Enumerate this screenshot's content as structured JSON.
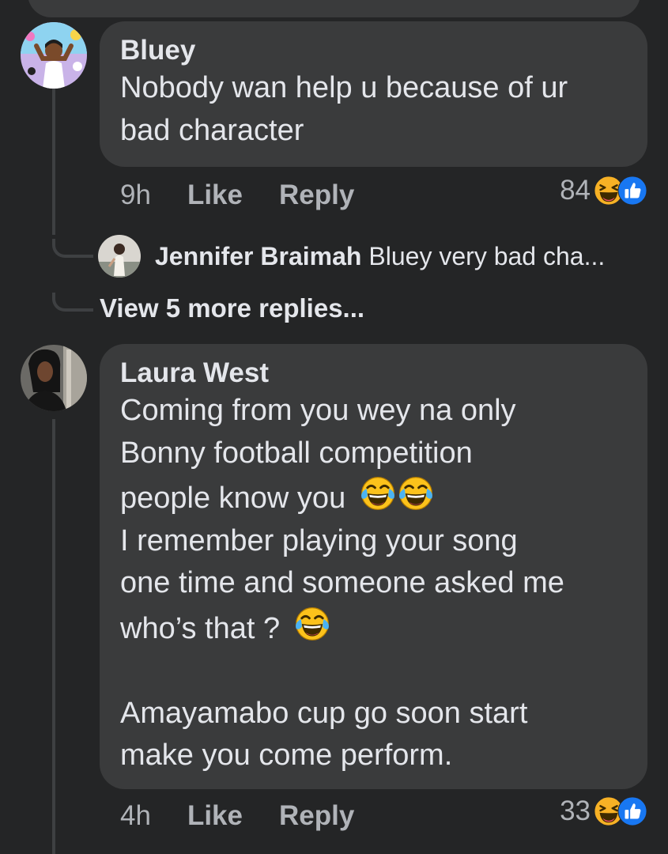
{
  "comments": [
    {
      "author": "Bluey",
      "text": "Nobody wan help u because of ur\nbad character",
      "time": "9h",
      "like_label": "Like",
      "reply_label": "Reply",
      "reaction_count": "84",
      "reactions": [
        "haha-emoji",
        "like-reaction"
      ],
      "reply_preview": {
        "author": "Jennifer Braimah",
        "text": "Bluey very bad cha..."
      },
      "view_more_label": "View 5 more replies..."
    },
    {
      "author": "Laura West",
      "text_line_1": "Coming from you wey na only",
      "text_line_2": "Bonny football competition",
      "text_line_3": "people know you",
      "text_line_4": "I remember playing your song",
      "text_line_5": "one time and someone asked me",
      "text_line_6": "who’s that ?",
      "text_line_7": "Amayamabo cup go soon start",
      "text_line_8": "make you come perform.",
      "emojis": [
        "tears-of-joy-emoji",
        "tears-of-joy-emoji",
        "tears-of-joy-emoji"
      ],
      "time": "4h",
      "like_label": "Like",
      "reply_label": "Reply",
      "reaction_count": "33",
      "reactions": [
        "haha-emoji",
        "like-reaction"
      ]
    }
  ],
  "colors": {
    "background": "#242526",
    "bubble": "#3a3b3c",
    "text": "#e4e6eb",
    "secondary_text": "#b0b3b8",
    "like_blue": "#1877f2",
    "haha_yellow": "#f7b125"
  }
}
